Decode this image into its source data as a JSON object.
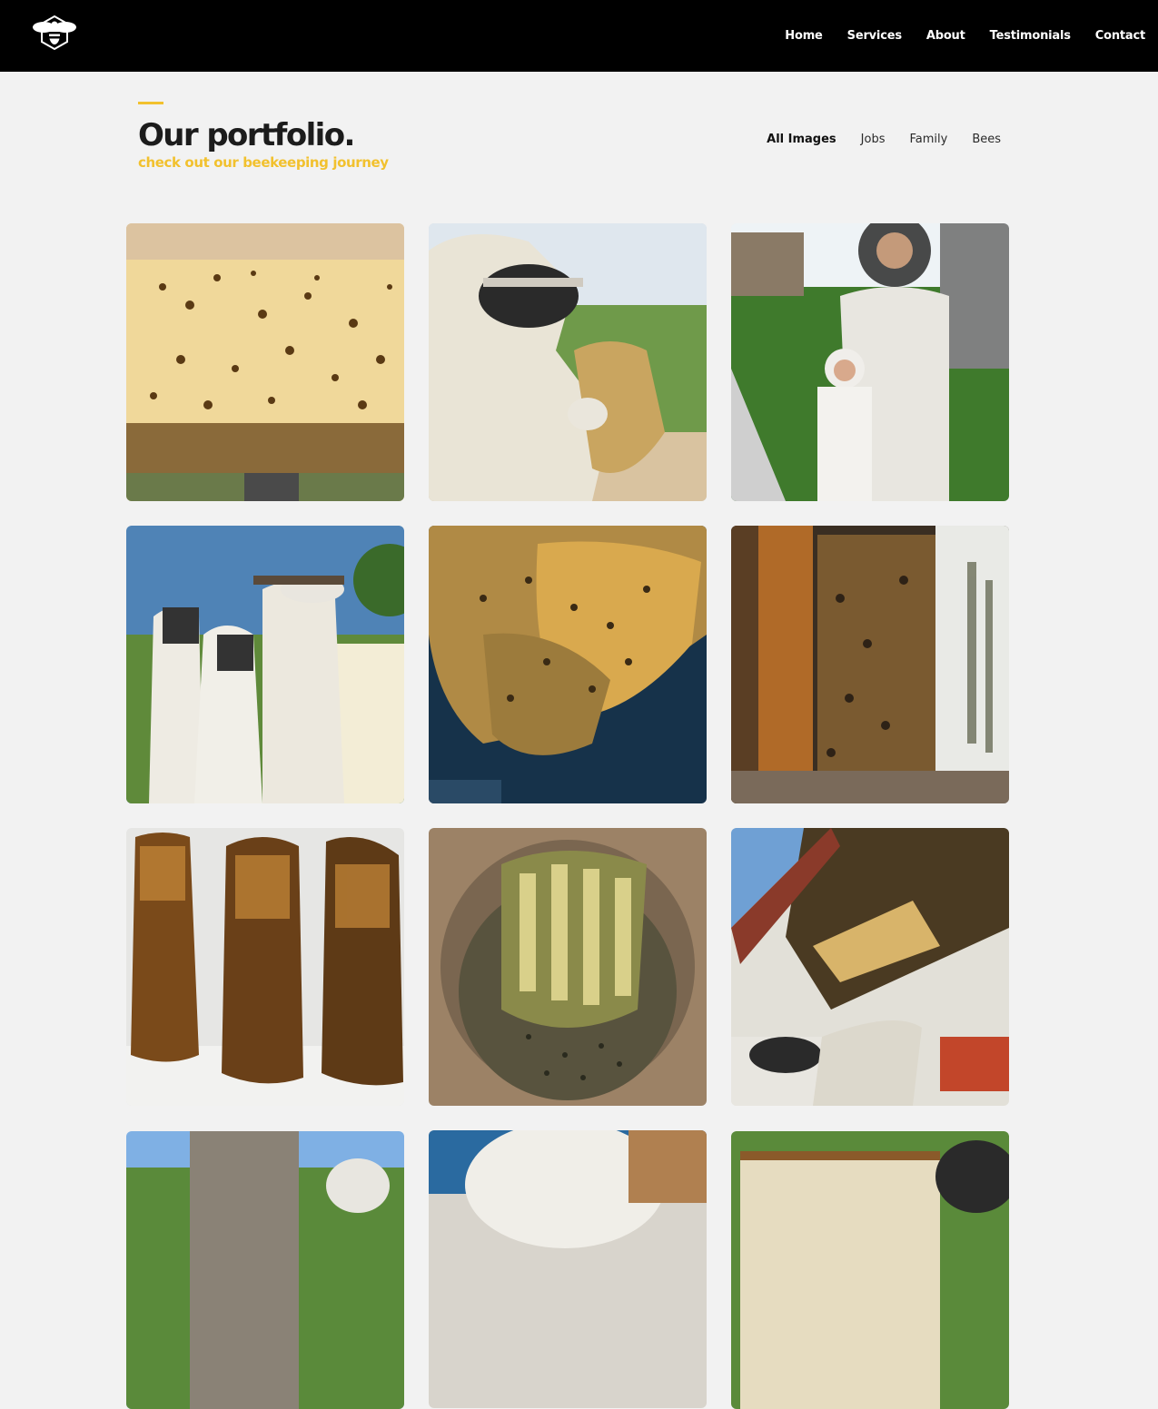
{
  "nav": {
    "logo_icon": "bee-icon",
    "items": [
      "Home",
      "Services",
      "About",
      "Testimonials",
      "Contact"
    ]
  },
  "header": {
    "title": "Our portfolio.",
    "subtitle": "check out our beekeeping journey",
    "accent_color": "#f2c12e"
  },
  "filters": {
    "items": [
      "All Images",
      "Jobs",
      "Family",
      "Bees"
    ],
    "active": "All Images"
  },
  "gallery": {
    "tiles": [
      "hive-swarm-photo",
      "beekeeper-comb-photo",
      "family-suits-photo",
      "family-hive-inspection-photo",
      "honeycomb-closeup-photo",
      "wall-colony-removal-photo",
      "comb-slabs-photo",
      "bucket-colony-photo",
      "ceiling-colony-removal-photo",
      "chimney-removal-photo",
      "suited-beekeeper-photo",
      "frame-inspection-photo"
    ]
  }
}
